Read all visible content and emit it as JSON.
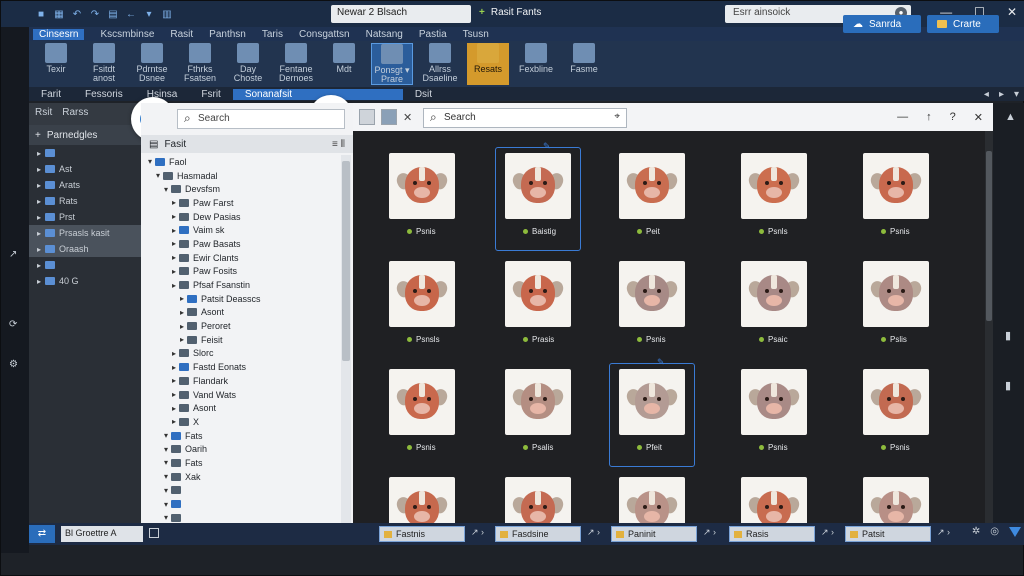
{
  "titlebar": {
    "document_tab": "Newar 2 Blsach",
    "app_label": "Rasit Fants",
    "search_placeholder": "Esrr ainsoick",
    "buttons": {
      "minimize": "—",
      "maximize": "☐",
      "close": "✕"
    }
  },
  "menubar": {
    "items": [
      "Cinsesrn",
      "Kscsmbinse",
      "Rasit",
      "Panthsn",
      "Taris",
      "Consgattsn",
      "Natsang",
      "Pastia",
      "Tsusn"
    ]
  },
  "ribbon": {
    "groups": [
      {
        "label": "Texir",
        "icon": "library-icon"
      },
      {
        "label": "Fsitdt anost",
        "icon": "folder-icon"
      },
      {
        "label": "Pdrntse Dsnee",
        "icon": "search-icon"
      },
      {
        "label": "Fthrks Fsatsen",
        "icon": "layers-icon"
      },
      {
        "label": "Day Choste",
        "icon": "calendar-icon"
      },
      {
        "label": "Fentane Dernoes",
        "icon": "grid-icon"
      },
      {
        "label": "Mdt",
        "icon": "document-icon"
      },
      {
        "label": "Ponsgt ▾ Prare",
        "icon": "page-icon"
      },
      {
        "label": "Allrss Dsaeline",
        "icon": "sync-icon"
      },
      {
        "label": "Resats",
        "icon": "star-icon"
      },
      {
        "label": "Fexbline",
        "icon": "gear-icon"
      },
      {
        "label": "Fasme",
        "icon": "cube-icon"
      }
    ],
    "search_button": "Sanrda",
    "create_button": "Crarte"
  },
  "tabsbar": {
    "items": [
      "Farit",
      "Fessoris",
      "Hsinsa",
      "Fsrit",
      "Sonanafsit",
      "Dsit"
    ],
    "active_index": 4
  },
  "side_panel": {
    "header_items": [
      "Rsit",
      "Rarss"
    ],
    "title": "Parnedgles",
    "rows": [
      {
        "label": "",
        "selected": false
      },
      {
        "label": "Ast",
        "selected": false
      },
      {
        "label": "Arats",
        "selected": false
      },
      {
        "label": "Rats",
        "selected": false
      },
      {
        "label": "Prst",
        "selected": false
      },
      {
        "label": "Prsasls kasit",
        "selected": true
      },
      {
        "label": "Oraash",
        "selected": true
      },
      {
        "label": "",
        "selected": false
      },
      {
        "label": "40 G",
        "selected": false
      }
    ]
  },
  "tree_panel": {
    "search_placeholder": "Search",
    "header": "Fasit",
    "items": [
      {
        "label": "Faol",
        "depth": 0
      },
      {
        "label": "Hasmadal",
        "depth": 1
      },
      {
        "label": "Devsfsm",
        "depth": 2
      },
      {
        "label": "Paw Farst",
        "depth": 3
      },
      {
        "label": "Dew Pasias",
        "depth": 3
      },
      {
        "label": "Vaim sk",
        "depth": 3
      },
      {
        "label": "Paw Basats",
        "depth": 3
      },
      {
        "label": "Ewir Clants",
        "depth": 3
      },
      {
        "label": "Paw Fosits",
        "depth": 3
      },
      {
        "label": "Pfsaf Fsanstin",
        "depth": 3
      },
      {
        "label": "Patsit Deasscs",
        "depth": 4
      },
      {
        "label": "Asont",
        "depth": 4
      },
      {
        "label": "Peroret",
        "depth": 4
      },
      {
        "label": "Feisit",
        "depth": 4
      },
      {
        "label": "Slorc",
        "depth": 3
      },
      {
        "label": "Fastd Eonats",
        "depth": 3
      },
      {
        "label": "Flandark",
        "depth": 3
      },
      {
        "label": "Vand Wats",
        "depth": 3
      },
      {
        "label": "Asont",
        "depth": 3
      },
      {
        "label": "X",
        "depth": 3
      },
      {
        "label": "Fats",
        "depth": 2
      },
      {
        "label": "Oarih",
        "depth": 2
      },
      {
        "label": "Fats",
        "depth": 2
      },
      {
        "label": "Xak",
        "depth": 2
      },
      {
        "label": "",
        "depth": 2
      },
      {
        "label": "",
        "depth": 2
      },
      {
        "label": "",
        "depth": 2
      }
    ]
  },
  "content_toolbar": {
    "search_placeholder": "Search",
    "right_buttons": [
      "—",
      "↑",
      "?",
      "✕"
    ]
  },
  "grid": {
    "columns": 5,
    "rows": 4,
    "items": [
      {
        "label": "Psnis",
        "tone": "#c86a4f",
        "selected": false
      },
      {
        "label": "Baistig",
        "tone": "#c46a52",
        "selected": true
      },
      {
        "label": "Peit",
        "tone": "#c96d50",
        "selected": false
      },
      {
        "label": "Psnls",
        "tone": "#cc6e4f",
        "selected": false
      },
      {
        "label": "Psnis",
        "tone": "#c8694e",
        "selected": false
      },
      {
        "label": "Psnsls",
        "tone": "#c7664a",
        "selected": false
      },
      {
        "label": "Prasis",
        "tone": "#c8674c",
        "selected": false
      },
      {
        "label": "Psnis",
        "tone": "#a78a86",
        "selected": false
      },
      {
        "label": "Psaic",
        "tone": "#a88986",
        "selected": false
      },
      {
        "label": "Pslis",
        "tone": "#ad8a84",
        "selected": false
      },
      {
        "label": "Psnis",
        "tone": "#c9694d",
        "selected": false
      },
      {
        "label": "Psalis",
        "tone": "#b48e82",
        "selected": false
      },
      {
        "label": "Pfeit",
        "tone": "#b39b94",
        "selected": true
      },
      {
        "label": "Psnis",
        "tone": "#a98a86",
        "selected": false
      },
      {
        "label": "Psnis",
        "tone": "#c26a51",
        "selected": false
      },
      {
        "label": "",
        "tone": "#c6694d",
        "selected": false
      },
      {
        "label": "",
        "tone": "#c46a52",
        "selected": false
      },
      {
        "label": "",
        "tone": "#b99288",
        "selected": false
      },
      {
        "label": "",
        "tone": "#c86c50",
        "selected": false
      },
      {
        "label": "",
        "tone": "#b88f86",
        "selected": false
      }
    ]
  },
  "bottom_bar": {
    "crumb": "Bl Groettre A",
    "chips": [
      "Fastnis",
      "Fasdsine",
      "Paninit",
      "Rasis",
      "Patsit"
    ]
  }
}
